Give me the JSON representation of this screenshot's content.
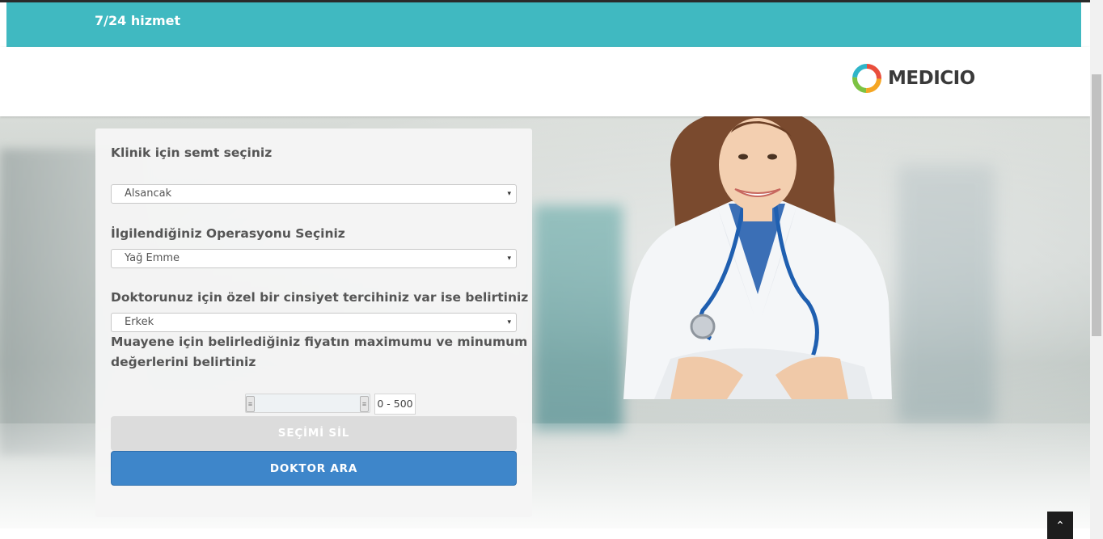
{
  "topbar": {
    "text": "7/24 hizmet"
  },
  "brand": {
    "name": "MEDICIO",
    "logo": "ring-logo-icon"
  },
  "form": {
    "district": {
      "label": "Klinik için semt seçiniz",
      "value": "Alsancak"
    },
    "operation": {
      "label": "İlgilendiğiniz Operasyonu Seçiniz",
      "value": "Yağ Emme"
    },
    "gender": {
      "label": "Doktorunuz için özel bir cinsiyet tercihiniz var ise belirtiniz",
      "value": "Erkek"
    },
    "price": {
      "label_line1": "Muayene için belirlediğiniz fiyatın maximumu ve minumum",
      "label_line2": "değerlerini belirtiniz",
      "range": "0 - 500"
    },
    "clear_button": "SEÇİMİ SİL",
    "search_button": "DOKTOR ARA"
  },
  "icons": {
    "dropdown": "▾",
    "slider_handle": "≡",
    "back_to_top": "⌃"
  },
  "colors": {
    "topbar": "#40b9c1",
    "primary_button": "#3e86ca",
    "clear_button": "#dcdcdc"
  }
}
